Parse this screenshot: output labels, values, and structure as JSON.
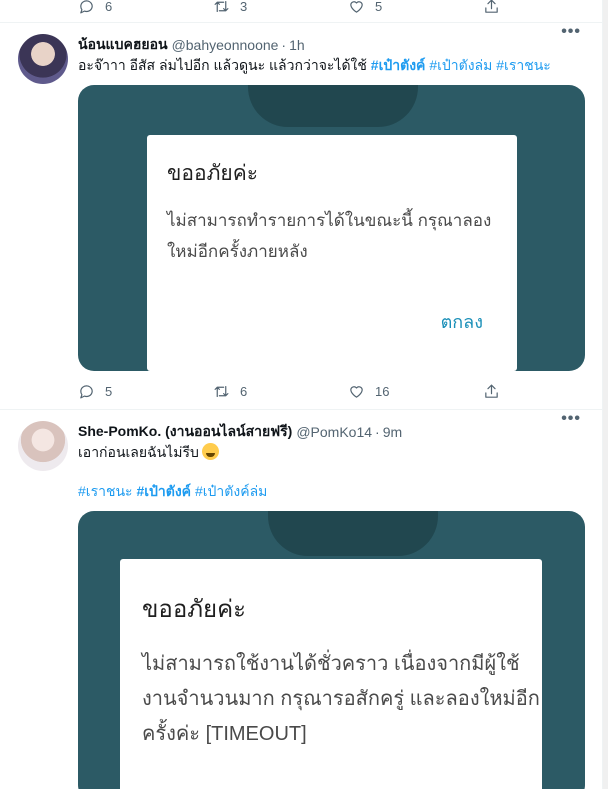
{
  "prev_tweet": {
    "reply_count": "6",
    "retweet_count": "3",
    "like_count": "5"
  },
  "tweets": [
    {
      "name": "น้อนแบคฮยอน",
      "handle": "@bahyeonnoone",
      "time": "1h",
      "more": "•••",
      "text_plain": "อะจ๊าาา อีสัส ล่มไปอีก แล้วดูนะ แล้วกว่าจะได้ใช้",
      "hashtags": [
        "#เป๋าตังค์",
        "#เป๋าตังล่ม",
        "#เราชนะ"
      ],
      "dialog": {
        "title": "ขออภัยค่ะ",
        "body": "ไม่สามารถทำรายการได้ในขณะนี้ กรุณาลองใหม่อีกครั้งภายหลัง",
        "button": "ตกลง"
      },
      "reply_count": "5",
      "retweet_count": "6",
      "like_count": "16"
    },
    {
      "name": "She-PomKo. (งานออนไลน์สายฟรี)",
      "handle": "@PomKo14",
      "time": "9m",
      "more": "•••",
      "text_plain": "เอาก่อนเลยฉันไม่รีบ",
      "emoji": "hugging-face-emoji",
      "hashtags": [
        "#เราชนะ",
        "#เป๋าตังค์",
        "#เป๋าตังค์ล่ม"
      ],
      "dialog": {
        "title": "ขออภัยค่ะ",
        "body": "ไม่สามารถใช้งานได้ชั่วคราว เนื่องจากมีผู้ใช้งานจำนวนมาก กรุณารอสักครู่ และลองใหม่อีกครั้งค่ะ [TIMEOUT]"
      }
    }
  ],
  "colors": {
    "accent": "#1d9bf0",
    "media_bg": "#2c5a65",
    "dialog_button": "#1a8fb8",
    "muted": "#536471"
  },
  "icons": [
    "reply-icon",
    "retweet-icon",
    "like-icon",
    "share-icon",
    "more-icon"
  ]
}
